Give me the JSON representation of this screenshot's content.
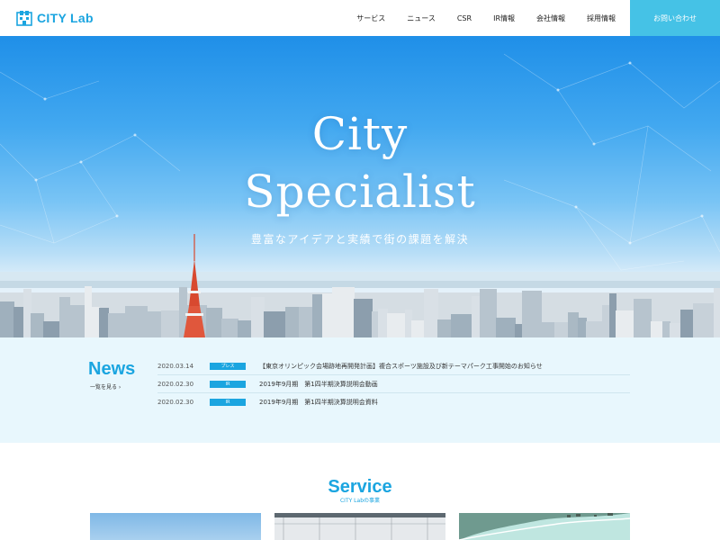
{
  "header": {
    "logo_text": "CITY Lab",
    "nav": [
      "サービス",
      "ニュース",
      "CSR",
      "IR情報",
      "会社情報",
      "採用情報"
    ],
    "contact_label": "お問い合わせ"
  },
  "hero": {
    "title_line1": "City",
    "title_line2": "Specialist",
    "subtitle": "豊富なアイデアと実績で街の課題を解決"
  },
  "news": {
    "title": "News",
    "more_label": "一覧を見る ›",
    "items": [
      {
        "date": "2020.03.14",
        "category": "プレス",
        "text": "【東京オリンピック会場跡地再開発計画】複合スポーツ施設及び新テーマパーク工事開始のお知らせ"
      },
      {
        "date": "2020.02.30",
        "category": "IR",
        "text": "2019年9月期　第1四半期決算説明会動画"
      },
      {
        "date": "2020.02.30",
        "category": "IR",
        "text": "2019年9月期　第1四半期決算説明会資料"
      }
    ]
  },
  "service": {
    "title": "Service",
    "subtitle": "CITY Labの事業"
  },
  "colors": {
    "accent": "#1ba5e0",
    "contact_bg": "#45c2e6",
    "news_bg": "#e8f7fd"
  },
  "icons": {
    "logo": "city-building-icon",
    "more": "chevron-right-icon"
  }
}
